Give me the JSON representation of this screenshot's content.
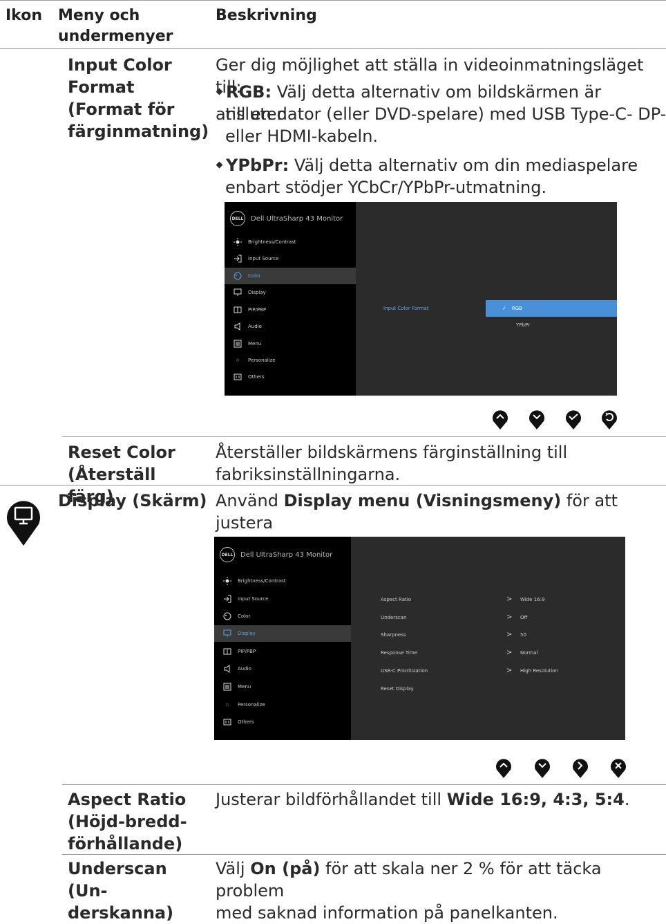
{
  "header": {
    "col_icon": "Ikon",
    "col_menu": "Meny och undermenyer",
    "col_desc": "Beskrivning"
  },
  "input_color": {
    "name": "Input Color Format (Format för färginmatning)",
    "desc_intro": "Ger dig möjlighet att ställa in videoinmatningsläget till:",
    "rgb_label": "RGB:",
    "rgb_text": "Välj detta alternativ om bildskärmen är ansluten till en dator (eller DVD-spelare) med USB Type-C- DP- eller HDMI-kabeln.",
    "ypbpr_label": "YPbPr:",
    "ypbpr_text": "Välj detta alternativ om din mediaspelare enbart stödjer YCbCr/YPbPr-utmatning."
  },
  "osd1": {
    "brand": "Dell UltraSharp 43 Monitor",
    "logo": "DELL",
    "menu": [
      "Brightness/Contrast",
      "Input Source",
      "Color",
      "Display",
      "PIP/PBP",
      "Audio",
      "Menu",
      "Personalize",
      "Others"
    ],
    "setting": "Input Color Format",
    "options": [
      "RGB",
      "YPbPr"
    ]
  },
  "reset_color": {
    "name": "Reset Color (Återställ färg)",
    "desc": "Återställer bildskärmens färginställning till fabriksinställningarna."
  },
  "display": {
    "name": "Display (Skärm)",
    "desc_pre": "Använd",
    "desc_bold": "Display menu (Visningsmeny)",
    "desc_post": "för att justera bilden."
  },
  "osd2": {
    "brand": "Dell UltraSharp 43 Monitor",
    "logo": "DELL",
    "menu": [
      "Brightness/Contrast",
      "Input Source",
      "Color",
      "Display",
      "PIP/PBP",
      "Audio",
      "Menu",
      "Personalize",
      "Others"
    ],
    "rows": [
      {
        "label": "Aspect Ratio",
        "value": "Wide 16:9"
      },
      {
        "label": "Underscan",
        "value": "Off"
      },
      {
        "label": "Sharpness",
        "value": "50"
      },
      {
        "label": "Response Time",
        "value": "Normal"
      },
      {
        "label": "USB-C Prioritization",
        "value": "High Resolution"
      },
      {
        "label": "Reset Display",
        "value": ""
      }
    ]
  },
  "aspect": {
    "name": "Aspect Ratio (Höjd-bredd-förhållande)",
    "desc_pre": "Justerar bildförhållandet till",
    "desc_bold": "Wide 16:9, 4:3, 5:4",
    "desc_post": "."
  },
  "underscan": {
    "name": "Underscan (Underskanna)",
    "desc_pre": "Välj",
    "desc_bold": "On (på)",
    "desc_post": "för att skala ner 2 % för att täcka problem med saknad information på panelkanten."
  },
  "colors": {
    "osd_bg": "#2b2b2b",
    "osd_left": "#000000",
    "highlight": "#4a90d9",
    "accent_text": "#5ba3e0"
  }
}
